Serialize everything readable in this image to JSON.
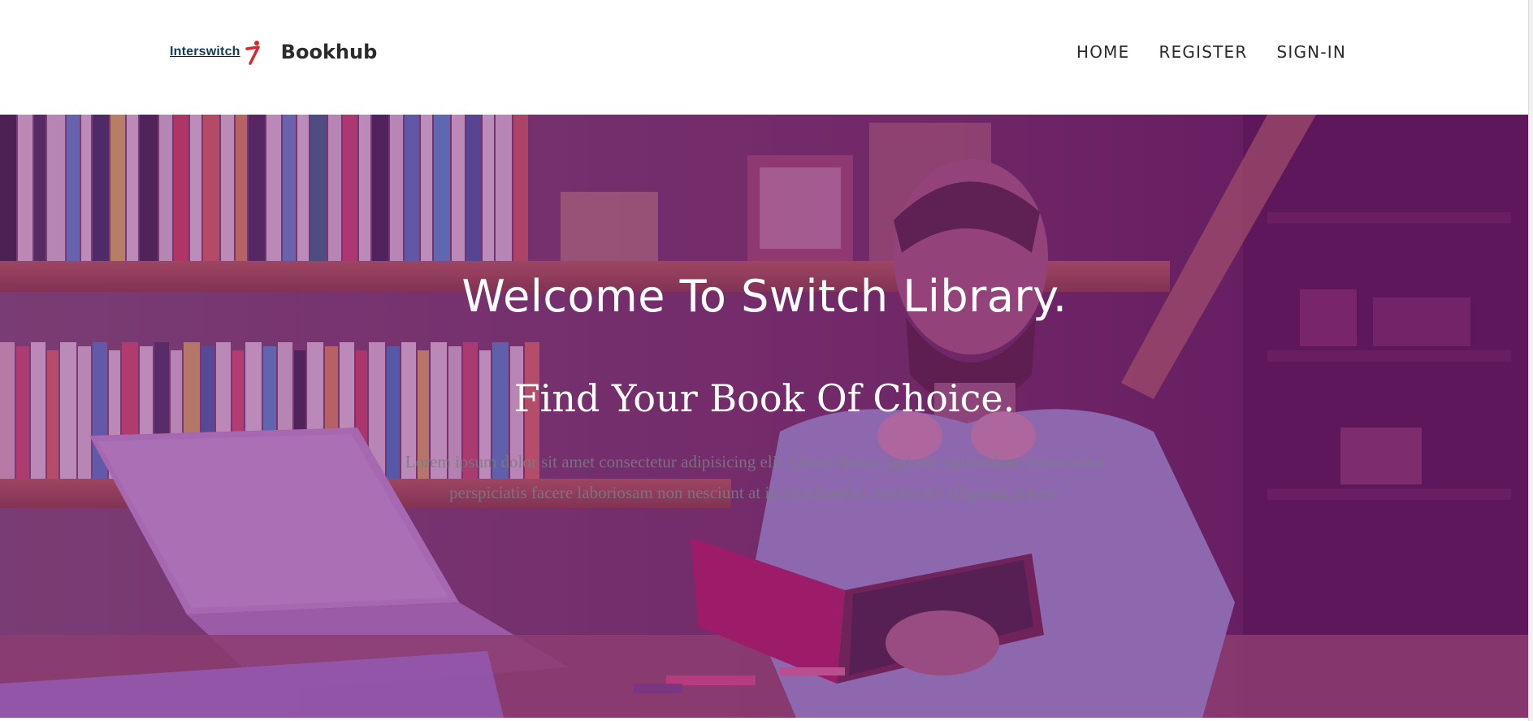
{
  "header": {
    "logo_text": "Interswitch",
    "brand_name": "Bookhub",
    "nav": [
      {
        "label": "HOME"
      },
      {
        "label": "REGISTER"
      },
      {
        "label": "SIGN-IN"
      }
    ]
  },
  "hero": {
    "title": "Welcome To Switch Library.",
    "subtitle": "Find Your Book Of Choice.",
    "description": "Lorem ipsum dolor sit amet consectetur adipisicing elit. Quam beatae sapiente quibusdam consequatur perspiciatis facere laboriosam non nesciunt at id repudiandae, modi iste? Eligendi, rerum!",
    "overlay_color": "#7a147a",
    "image": "library-reading-photo"
  },
  "colors": {
    "logo_blue": "#0f3b57",
    "logo_red": "#d6262f",
    "nav_text": "#2a2a2a",
    "hero_text": "#ffffff"
  }
}
